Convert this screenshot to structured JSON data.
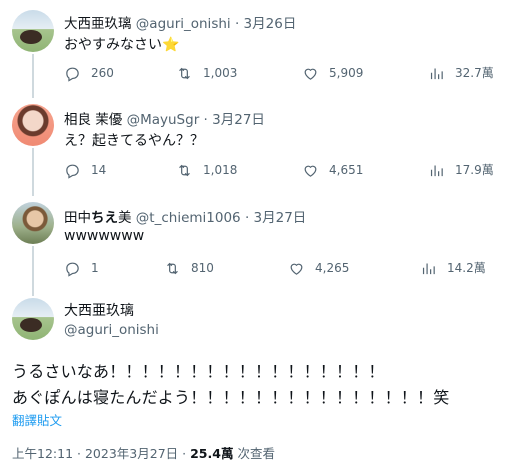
{
  "tweets": [
    {
      "name": "大西亜玖璃",
      "handle": "@aguri_onishi",
      "sep": "·",
      "date": "3月26日",
      "text": "おやすみなさい",
      "emoji": "⭐",
      "replies": "260",
      "retweets": "1,003",
      "likes": "5,909",
      "views": "32.7萬"
    },
    {
      "name": "相良 茉優",
      "handle": "@MayuSgr",
      "sep": "·",
      "date": "3月27日",
      "text": "え？起きてるやん？？",
      "replies": "14",
      "retweets": "1,018",
      "likes": "4,651",
      "views": "17.9萬"
    },
    {
      "name_a": "田中",
      "name_b": "ちえ",
      "name_c": "美",
      "handle": "@t_chiemi1006",
      "sep": "·",
      "date": "3月27日",
      "text": "wwwwwww",
      "replies": "1",
      "retweets": "810",
      "likes": "4,265",
      "views": "14.2萬"
    }
  ],
  "main": {
    "name": "大西亜玖璃",
    "handle": "@aguri_onishi",
    "line1": "うるさいなあ！！！！！！！！！！！！！！！！！",
    "line2": "あぐぽんは寝たんだよう！！！！！！！！！！！！！！！笑",
    "translate": "翻譯貼文",
    "time": "上午12:11",
    "sep": "·",
    "date": "2023年3月27日",
    "views_count": "25.4萬",
    "views_label": "次查看"
  }
}
